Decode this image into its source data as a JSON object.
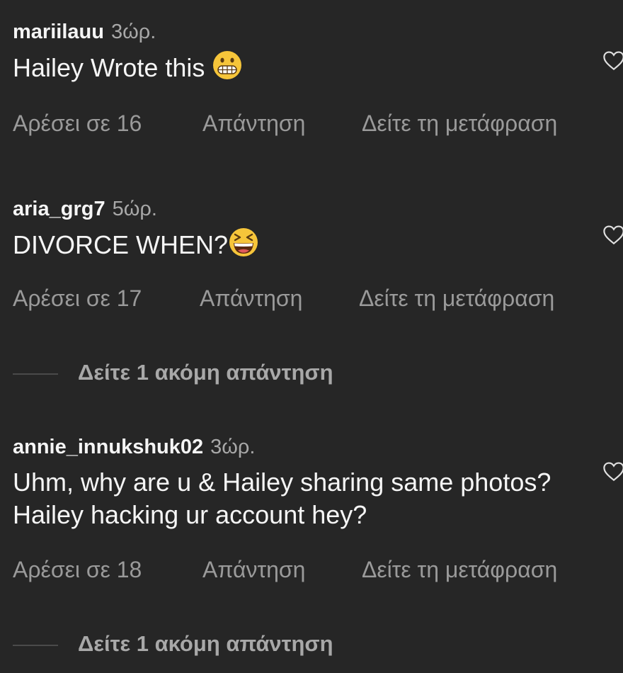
{
  "comments": [
    {
      "username": "mariilauu",
      "time": "3ώρ.",
      "text": "Hailey Wrote this",
      "emoji": "grimacing-face-emoji",
      "likes": "Αρέσει σε 16",
      "reply": "Απάντηση",
      "translate": "Δείτε τη μετάφραση"
    },
    {
      "username": "aria_grg7",
      "time": "5ώρ.",
      "text": "DIVORCE WHEN?",
      "emoji": "grinning-squinting-face-emoji",
      "likes": "Αρέσει σε 17",
      "reply": "Απάντηση",
      "translate": "Δείτε τη μετάφραση",
      "more_replies": "Δείτε 1 ακόμη απάντηση"
    },
    {
      "username": "annie_innukshuk02",
      "time": "3ώρ.",
      "text": "Uhm, why are u & Hailey sharing same photos? Hailey hacking ur account hey?",
      "likes": "Αρέσει σε 18",
      "reply": "Απάντηση",
      "translate": "Δείτε τη μετάφραση",
      "more_replies": "Δείτε 1 ακόμη απάντηση"
    }
  ],
  "colors": {
    "background": "#262626",
    "primary_text": "#f5f5f5",
    "secondary_text": "#9a9a9a",
    "emoji_yellow": "#f6c53a"
  },
  "icons": {
    "like": "heart-outline-icon"
  }
}
